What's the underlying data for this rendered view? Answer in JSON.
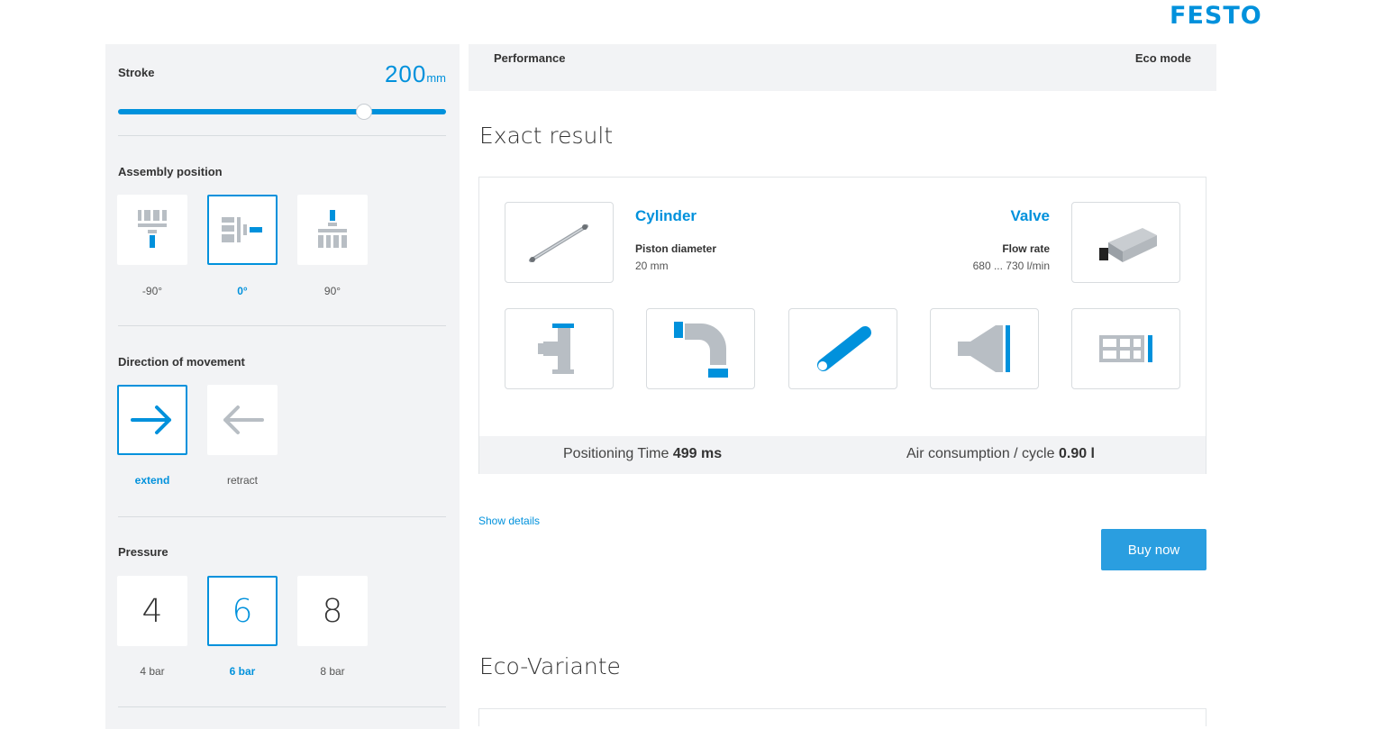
{
  "brand": {
    "logo": "FESTO"
  },
  "stroke": {
    "title": "Stroke",
    "value": "200",
    "unit": "mm",
    "slider_fraction": 0.75
  },
  "assembly": {
    "title": "Assembly position",
    "options": [
      {
        "label": "-90°",
        "icon": "vertical-mount-down-icon"
      },
      {
        "label": "0°",
        "icon": "horizontal-mount-icon",
        "selected": true
      },
      {
        "label": "90°",
        "icon": "vertical-mount-up-icon"
      }
    ]
  },
  "direction": {
    "title": "Direction of movement",
    "options": [
      {
        "label": "extend",
        "icon": "arrow-right-icon",
        "selected": true
      },
      {
        "label": "retract",
        "icon": "arrow-left-icon"
      }
    ]
  },
  "pressure": {
    "title": "Pressure",
    "options": [
      {
        "value": "4",
        "label": "4 bar"
      },
      {
        "value": "6",
        "label": "6 bar",
        "selected": true
      },
      {
        "value": "8",
        "label": "8 bar"
      }
    ]
  },
  "perf_bar": {
    "left": "Performance",
    "right": "Eco mode"
  },
  "exact": {
    "heading": "Exact result",
    "cylinder": {
      "title": "Cylinder",
      "sub": "Piston diameter",
      "value": "20 mm"
    },
    "valve": {
      "title": "Valve",
      "sub": "Flow rate",
      "value": "680 ... 730 l/min"
    },
    "accessories": [
      "tee-fitting-icon",
      "elbow-fitting-icon",
      "tubing-icon",
      "silencer-icon",
      "valve-manifold-icon"
    ],
    "positioning": {
      "label": "Positioning Time",
      "value": "499 ms"
    },
    "air": {
      "label": "Air consumption / cycle",
      "value": "0.90 l"
    }
  },
  "show_details": "Show details",
  "buy_now": "Buy now",
  "eco": {
    "heading": "Eco-Variante"
  },
  "colors": {
    "accent": "#0091dc",
    "panel": "#f2f3f5",
    "button": "#2a9ee0"
  }
}
